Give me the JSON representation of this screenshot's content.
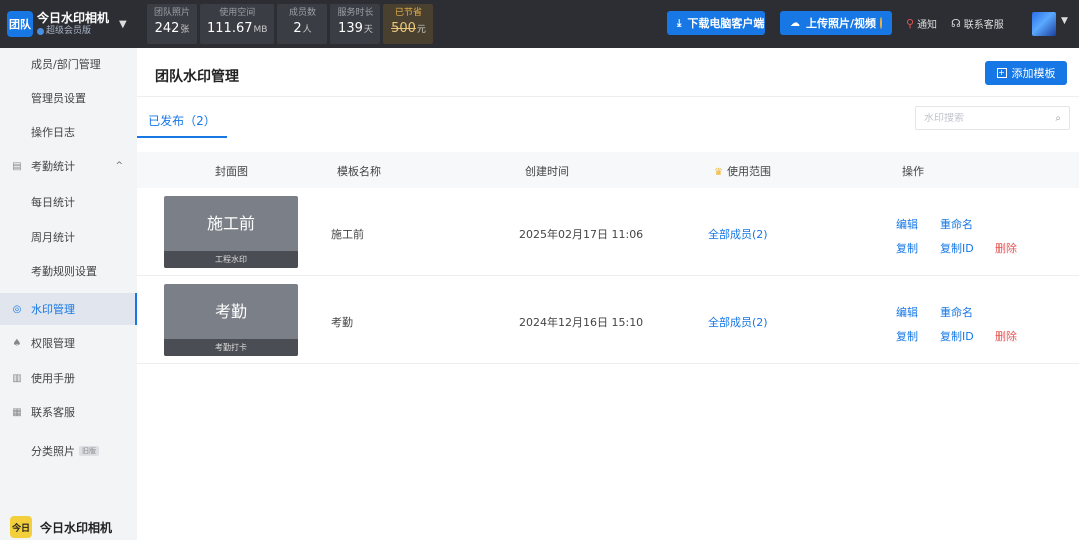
{
  "app": {
    "brand_logo": "团队",
    "brand_name": "今日水印相机",
    "brand_sub": "超级会员版"
  },
  "stats": [
    {
      "label": "团队照片",
      "value": "242",
      "unit": "张"
    },
    {
      "label": "使用空间",
      "value": "111.67",
      "unit": "MB"
    },
    {
      "label": "成员数",
      "value": "2",
      "unit": "人"
    },
    {
      "label": "服务时长",
      "value": "139",
      "unit": "天"
    },
    {
      "label": "已节省",
      "value": "500",
      "unit": "元"
    }
  ],
  "topbar": {
    "download_label": "下载电脑客户端",
    "upload_label": "上传照片/视频",
    "notify_label": "通知",
    "service_label": "联系客服"
  },
  "sidebar": {
    "items": [
      {
        "label": "成员/部门管理"
      },
      {
        "label": "管理员设置"
      },
      {
        "label": "操作日志"
      },
      {
        "label": "考勤统计"
      },
      {
        "label": "每日统计"
      },
      {
        "label": "周月统计"
      },
      {
        "label": "考勤规则设置"
      },
      {
        "label": "水印管理"
      },
      {
        "label": "权限管理"
      },
      {
        "label": "使用手册"
      },
      {
        "label": "联系客服"
      },
      {
        "label": "分类照片",
        "tag": "旧版"
      }
    ],
    "footer_logo": "今日",
    "footer_name": "今日水印相机"
  },
  "main": {
    "title": "团队水印管理",
    "add_label": "添加模板",
    "tab_label": "已发布（2）",
    "search_placeholder": "水印搜索",
    "columns": {
      "cover": "封面图",
      "name": "模板名称",
      "created": "创建时间",
      "scope": "使用范围",
      "ops": "操作"
    },
    "ops_labels": {
      "edit": "编辑",
      "rename": "重命名",
      "copy": "复制",
      "copy_id": "复制ID",
      "delete": "删除"
    },
    "rows": [
      {
        "cover_title": "施工前",
        "cover_sub": "工程水印",
        "name": "施工前",
        "created": "2025年02月17日 11:06",
        "scope": "全部成员(2)"
      },
      {
        "cover_title": "考勤",
        "cover_sub": "考勤打卡",
        "name": "考勤",
        "created": "2024年12月16日 15:10",
        "scope": "全部成员(2)"
      }
    ]
  },
  "colors": {
    "accent": "#1677e5",
    "danger": "#e65353",
    "topbar": "#2c2e33"
  }
}
